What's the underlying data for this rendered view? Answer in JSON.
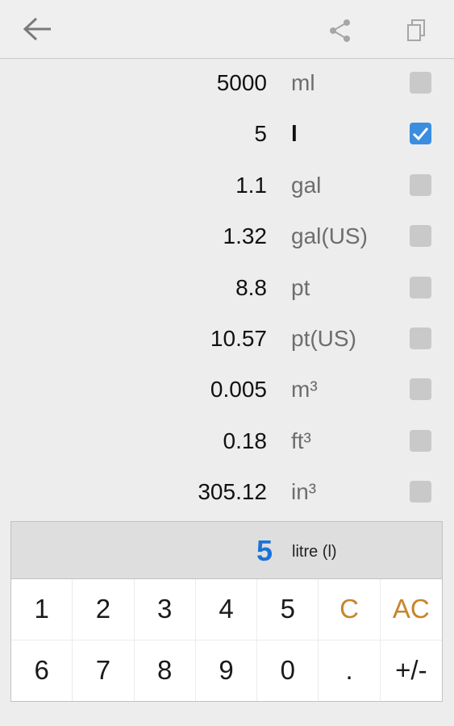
{
  "toolbar": {
    "back_icon": "arrow-left-icon",
    "share_icon": "share-icon",
    "copy_icon": "copy-icon",
    "icon_color": "#8a8a8a"
  },
  "conversions": [
    {
      "value": "5000",
      "unit": "ml",
      "checked": false
    },
    {
      "value": "5",
      "unit": "l",
      "checked": true
    },
    {
      "value": "1.1",
      "unit": "gal",
      "checked": false
    },
    {
      "value": "1.32",
      "unit": "gal(US)",
      "checked": false
    },
    {
      "value": "8.8",
      "unit": "pt",
      "checked": false
    },
    {
      "value": "10.57",
      "unit": "pt(US)",
      "checked": false
    },
    {
      "value": "0.005",
      "unit": "m³",
      "checked": false
    },
    {
      "value": "0.18",
      "unit": "ft³",
      "checked": false
    },
    {
      "value": "305.12",
      "unit": "in³",
      "checked": false
    }
  ],
  "display": {
    "value": "5",
    "unit_label": "litre (l)",
    "value_color": "#1a73d9"
  },
  "keypad": {
    "keys": [
      "1",
      "2",
      "3",
      "4",
      "5",
      "C",
      "AC",
      "6",
      "7",
      "8",
      "9",
      "0",
      ".",
      "+/-"
    ],
    "accent_color": "#c7852c"
  },
  "colors": {
    "checkbox_on": "#3b8de0",
    "checkbox_off": "#c9c9c9"
  }
}
